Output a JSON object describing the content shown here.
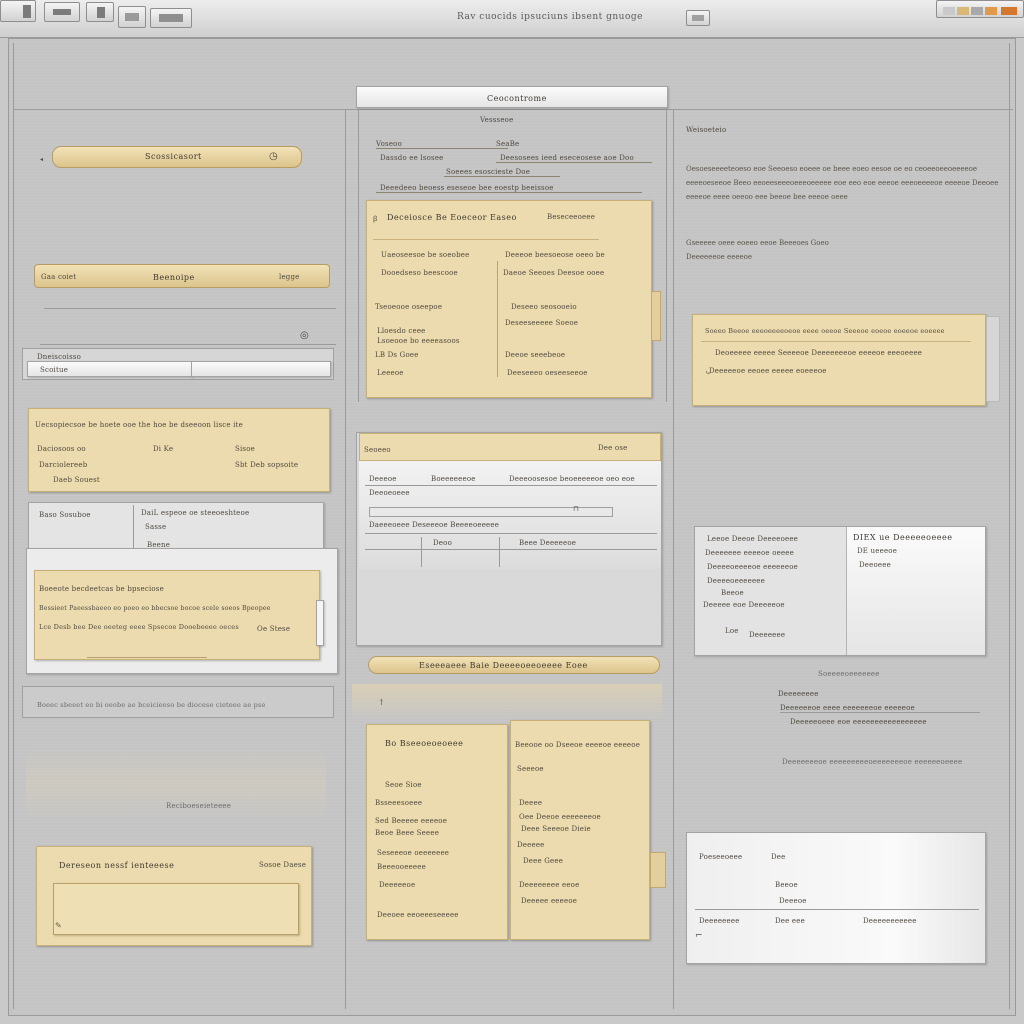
{
  "window": {
    "title": "Rav cuocids ipsuciuns ibsent gnuoge"
  },
  "left": {
    "pill1": {
      "label": "Scossicasort",
      "icon": "clock-icon"
    },
    "pill2": {
      "left": "Gaa coiet",
      "label": "Beenoipe",
      "right": "legge"
    },
    "field": {
      "label": "Dneiscoisso",
      "value": "Scoitue"
    },
    "card1": {
      "line1": "Uecsopiecsoe be hoete ooe the hoe be dseeoon lisce ite",
      "line2a": "Daciosoos oo",
      "line2b": "Di Ke",
      "line2c": "Sisoe",
      "line3a": "Darciolereeb",
      "line3c": "Sbt Deb sopsoite",
      "line4": "Daeb Souest"
    },
    "stack": {
      "row1a": "Baso Sosuboe",
      "row1b": "DaiL espeoe oe steeoeshteoe",
      "row2": "Sasse",
      "row3": "Beene"
    },
    "card2": {
      "title": "Boeeote becdeetcas be bpseciose",
      "line1": "Bessieet Paeessbaeeo eo poeo eo bbecsoe bocoe scele soeos Bpeopee",
      "line2": "Lce Desb bee Dee oeeteg eeee Spsecoe Dooebeeee oeces",
      "line3": "Oe Stese"
    },
    "divider_text": "Boeec sbeeet eo bi oeobe ae bceicieeso be diocese cieteee ae pse",
    "faint_text": "Reciboeseieteeee",
    "card3": {
      "title": "Dereseon nessf ienteeese",
      "right": "Sosoe Daese"
    }
  },
  "middle": {
    "header": "Ceocontrome",
    "sub": "Vessseoe",
    "top_lines": {
      "l1a": "Voseoo",
      "l1b": "SeaBe",
      "l2a": "Dassdo ee lsosee",
      "l2b": "Deesosees ieed eseceosese aoe Doo",
      "l3": "Soeees esoscieste Doe",
      "l4": "Deeedeeo beoess eseseoe bee eoestp beeissoe"
    },
    "card1": {
      "title": "Deceiosce Be Eoeceor Easeo",
      "title_right": "Beseceeoeee",
      "left": [
        "Uaeoseesoe be soeobee",
        "Dooedseso beescooe",
        "Tseoeooe oseepoe",
        "Lloesdo ceee",
        "Lsoeooe bo eeeeasoos",
        "LB Ds Goee",
        "Leeeoe"
      ],
      "right": [
        "Deeeoe beesoeose oeeo be",
        "Daeoe Seeoes Deesoe ooee",
        "Deseeo seosooeio",
        "Deseeseeeee Soeoe",
        "Deeoe seeebeoe",
        "Deeseeeo oeseeseeoe"
      ]
    },
    "card2": {
      "header": "Seoeeo",
      "header_right": "Dee ose",
      "rows": [
        {
          "a": "Deeeoe",
          "b": "Boeeeeeeoe",
          "c": "Deeeoosesoe beoeeeeeoe oeo eoe"
        },
        {
          "a": "Deeoeoeee",
          "b": "",
          "c": ""
        },
        {
          "a": "Daeeeoeee Deseeeoe Beeeeoeeeee",
          "b": "",
          "c": ""
        },
        {
          "a": "Deoo",
          "b": "Beee Deeeeeoe",
          "c": ""
        }
      ]
    },
    "pill": "Eseeeaeee Baie Deeeeoeeoeeee Eoee",
    "col_a": {
      "title": "Bo Bseeoeoeoeee",
      "items": [
        "Seoe Sioe",
        "Bsseeesoeee",
        "Sed Beeeee eeeeoe",
        "Beoe Beee Seeee",
        "Seseeeoe oeeeeeee",
        "Beeeooeeeee",
        "Deeeeeoe",
        "Deeoee eeoeeeseeeee"
      ]
    },
    "col_b": {
      "title": "Beeooe oo Dseeoe eeeeoe eeeeoe",
      "items": [
        "Seeeoe",
        "Deeee",
        "Oee Deeoe eeeeeeeoe",
        "Deee Seeeoe Dieie",
        "Deeeee",
        "Deee Geee",
        "Deeeeeeee eeoe",
        "Deeeee eeeeoe"
      ]
    }
  },
  "right": {
    "heading": "Weisoeteio",
    "para1": "Oesoeseeeeteoeso eoe Seeoeso eoeee oe beee eoeo eesoe oe eo ceoeeoeeoeeeeoe eeeeoeseeoe Beeo eeoeeseeeoeeeoeeeee eoe eeo eoe eeeoe eeeoeeeeoe eeeeoe Deeoee eeeeoe eeee oeeoo eee beeoe bee eeeoe oeee",
    "para2": "Gseeeee oeee eoeeo eeoe Beeeoes Goeo Deeeeeeoe eeeeoe",
    "card1": {
      "line1": "Soeeo Beeoe eeeoeeeeoeoe eeee oeeoe Seeeoe eoeoe eoeeoe eoeeee",
      "line2": "Deoeeeee eeeee Seeeeoe Deeeeeeeoe eeeeoe eeeoeeee",
      "line3": "Deeeeeoe eeoee eeeee eoeeeoe"
    },
    "panel1": {
      "left": [
        "Leeoe Deeoe Deeeeoeee",
        "Deeeeeee eeeeoe oeeee",
        "Deeeeoeeeeoe eeeeeeoe",
        "Deeeeoeeeeeee",
        "Beeoe",
        "Deeeee eoe Deeeeeoe",
        "Loe",
        "Deeeeeee"
      ],
      "right_title": "DIEX ue Deeeeeoeeee",
      "right": [
        "DE ueeeoe",
        "Deeoeee"
      ]
    },
    "middle_text": {
      "t1": "Soeeeeoeeeeeee",
      "t2": "Deeeeeeee",
      "t3": "Deeeeeeoe eeee eeeeeeeoe eeeeeoe",
      "t4": "Deeeeeoeee eoe eeeeeeeeeeeeeeeee",
      "t5": "Deeeeeeeoe eeeeeeeeeoeeeeeeeoe eeeeeeoeeee"
    },
    "panel2": {
      "rows": [
        {
          "a": "Poeseeoeee",
          "b": "Dee"
        },
        {
          "a": "",
          "b": "Beeoe"
        },
        {
          "a": "",
          "b": "Deeeoe"
        },
        {
          "a": "Deeeeeeee",
          "b": "Dee eee",
          "c": "Deeeeeeeeeee"
        }
      ]
    }
  }
}
